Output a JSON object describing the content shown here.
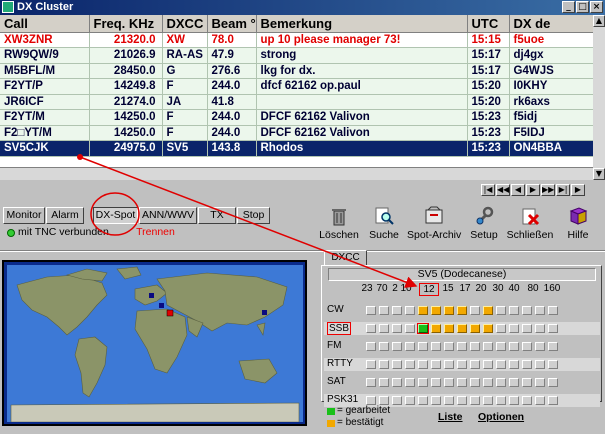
{
  "window": {
    "title": "DX Cluster",
    "buttons": [
      "_",
      "□",
      "×"
    ]
  },
  "grid": {
    "columns": [
      "Call",
      "Freq. KHz",
      "DXCC",
      "Beam °",
      "Bemerkung",
      "UTC",
      "DX de"
    ],
    "rows": [
      {
        "call": "XW3ZNR",
        "freq": "21320.0",
        "dxcc": "XW",
        "beam": "78.0",
        "note": "up 10 please manager 73!",
        "utc": "15:15",
        "de": "f5uoe",
        "style": "red"
      },
      {
        "call": "RW9QW/9",
        "freq": "21026.9",
        "dxcc": "RA-AS",
        "beam": "47.9",
        "note": "strong",
        "utc": "15:17",
        "de": "dj4gx",
        "style": "normal"
      },
      {
        "call": "M5BFL/M",
        "freq": "28450.0",
        "dxcc": "G",
        "beam": "276.6",
        "note": "lkg for dx.",
        "utc": "15:17",
        "de": "G4WJS",
        "style": "normal"
      },
      {
        "call": "F2YT/P",
        "freq": "14249.8",
        "dxcc": "F",
        "beam": "244.0",
        "note": "dfcf 62162 op.paul",
        "utc": "15:20",
        "de": "I0KHY",
        "style": "normal"
      },
      {
        "call": "JR6ICF",
        "freq": "21274.0",
        "dxcc": "JA",
        "beam": "41.8",
        "note": "",
        "utc": "15:20",
        "de": "rk6axs",
        "style": "normal"
      },
      {
        "call": "F2YT/M",
        "freq": "14250.0",
        "dxcc": "F",
        "beam": "244.0",
        "note": "DFCF 62162 Valivon",
        "utc": "15:23",
        "de": "f5idj",
        "style": "normal"
      },
      {
        "call": "F2□YT/M",
        "freq": "14250.0",
        "dxcc": "F",
        "beam": "244.0",
        "note": "DFCF 62162 Valivon",
        "utc": "15:23",
        "de": "F5IDJ",
        "style": "normal"
      },
      {
        "call": "SV5CJK",
        "freq": "24975.0",
        "dxcc": "SV5",
        "beam": "143.8",
        "note": "Rhodos",
        "utc": "15:23",
        "de": "ON4BBA",
        "style": "sel"
      }
    ]
  },
  "tabs": [
    {
      "label": "Monitor",
      "active": false
    },
    {
      "label": "Alarm",
      "active": false
    },
    {
      "label": "DX-Spot",
      "active": true
    },
    {
      "label": "ANN/WWV",
      "active": false
    },
    {
      "label": "TX",
      "active": false
    },
    {
      "label": "Stop",
      "active": false
    }
  ],
  "status": {
    "tnc_text": "mit TNC verbunden",
    "disconnect_label": "Trennen",
    "led_color": "#33cc33"
  },
  "toolbar": [
    {
      "label": "Löschen",
      "icon": "trash-icon"
    },
    {
      "label": "Suche",
      "icon": "search-icon"
    },
    {
      "label": "Spot-Archiv",
      "icon": "archive-icon"
    },
    {
      "label": "Setup",
      "icon": "wrench-icon"
    },
    {
      "label": "Schließen",
      "icon": "close-icon"
    },
    {
      "label": "Hilfe",
      "icon": "help-book-icon"
    }
  ],
  "dxcc": {
    "tab_label": "DXCC",
    "header": "SV5  (Dodecanese)",
    "bands": [
      "23",
      "70",
      "2",
      "10",
      "12",
      "15",
      "17",
      "20",
      "30",
      "40",
      "80",
      "160"
    ],
    "highlight_band": "12",
    "modes": [
      {
        "name": "CW",
        "cells": "nnnnccccncnn"
      },
      {
        "name": "SSB",
        "cells": "nnnnwcccccnn",
        "highlight": true
      },
      {
        "name": "FM",
        "cells": "nnnnnnnnnnnn"
      },
      {
        "name": "RTTY",
        "cells": "nnnnnnnnnnnn"
      },
      {
        "name": "SAT",
        "cells": "nnnnnnnnnnnn"
      },
      {
        "name": "PSK31",
        "cells": "nnnnnnnnnnnn"
      }
    ],
    "legend": [
      {
        "color": "#19c019",
        "text": "= gearbeitet"
      },
      {
        "color": "#f2a800",
        "text": "= bestätigt"
      }
    ],
    "links": [
      "Liste",
      "Optionen"
    ]
  },
  "colors": {
    "selection": "#0a246a",
    "alert_text": "#e00000",
    "annotation": "#e00000",
    "map_ocean": "#3d79d6",
    "map_land": "#8b9468"
  }
}
